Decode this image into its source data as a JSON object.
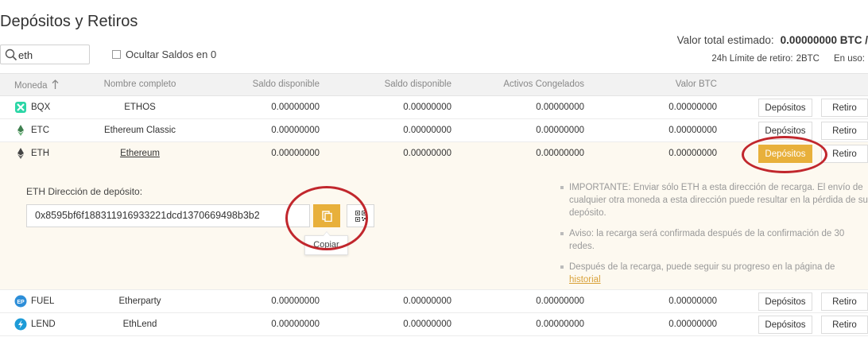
{
  "page": {
    "title": "Depósitos y Retiros"
  },
  "search": {
    "value": "eth",
    "placeholder": ""
  },
  "hide_zero": {
    "label": "Ocultar Saldos en 0",
    "checked": false
  },
  "summary": {
    "total_label": "Valor total estimado:",
    "total_value": "0.00000000 BTC /",
    "limit_label": "24h Límite de retiro:",
    "limit_value": "2BTC",
    "in_use_label": "En uso:"
  },
  "table": {
    "headers": {
      "coin": "Moneda",
      "name": "Nombre completo",
      "balance": "Saldo disponible",
      "balance2": "Saldo disponible",
      "frozen": "Activos Congelados",
      "btc": "Valor BTC"
    },
    "rows": [
      {
        "symbol": "BQX",
        "name": "ETHOS",
        "v1": "0.00000000",
        "v2": "0.00000000",
        "v3": "0.00000000",
        "v4": "0.00000000",
        "deposit": "Depósitos",
        "withdraw": "Retiro",
        "icon": "bqx-icon"
      },
      {
        "symbol": "ETC",
        "name": "Ethereum Classic",
        "v1": "0.00000000",
        "v2": "0.00000000",
        "v3": "0.00000000",
        "v4": "0.00000000",
        "deposit": "Depósitos",
        "withdraw": "Retiro",
        "icon": "etc-icon"
      },
      {
        "symbol": "ETH",
        "name": "Ethereum",
        "v1": "0.00000000",
        "v2": "0.00000000",
        "v3": "0.00000000",
        "v4": "0.00000000",
        "deposit": "Depósitos",
        "withdraw": "Retiro",
        "icon": "eth-icon"
      },
      {
        "symbol": "FUEL",
        "name": "Etherparty",
        "v1": "0.00000000",
        "v2": "0.00000000",
        "v3": "0.00000000",
        "v4": "0.00000000",
        "deposit": "Depósitos",
        "withdraw": "Retiro",
        "icon": "fuel-icon"
      },
      {
        "symbol": "LEND",
        "name": "EthLend",
        "v1": "0.00000000",
        "v2": "0.00000000",
        "v3": "0.00000000",
        "v4": "0.00000000",
        "deposit": "Depósitos",
        "withdraw": "Retiro",
        "icon": "lend-icon"
      }
    ]
  },
  "deposit_panel": {
    "label": "ETH Dirección de depósito:",
    "address": "0x8595bf6f188311916933221dcd1370669498b3b2",
    "copy_tooltip": "Copiar",
    "notes": [
      "IMPORTANTE: Enviar sólo ETH a esta dirección de recarga. El envío de cualquier otra moneda a esta dirección puede resultar en la pérdida de su depósito.",
      "Aviso: la recarga será confirmada después de la confirmación de 30 redes.",
      "Después de la recarga, puede seguir su progreso en la página de"
    ],
    "history_link": "historial",
    "trailing": "."
  },
  "colors": {
    "accent": "#e8b03b",
    "highlight_ring": "#c1272d",
    "row_active_bg": "#fdf9f0"
  }
}
